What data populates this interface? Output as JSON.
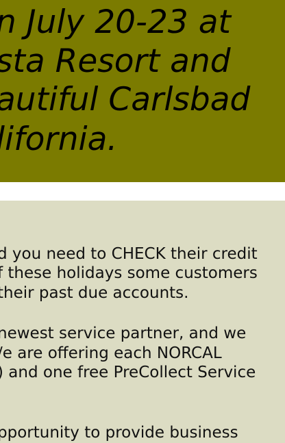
{
  "banner": {
    "lines": [
      "n July 20-23 at",
      "sta Resort and",
      "autiful Carlsbad",
      "lifornia."
    ]
  },
  "content": {
    "lines": [
      "d you need to CHECK their credit",
      "f these holidays some customers",
      "their past due accounts.",
      " newest service partner, and we",
      "/e are offering each NORCAL",
      ") and one free PreCollect Service",
      "pportunity to provide business"
    ]
  },
  "colors": {
    "banner_bg": "#7b7b00",
    "content_bg": "#dcdcc3",
    "text": "#111111"
  }
}
